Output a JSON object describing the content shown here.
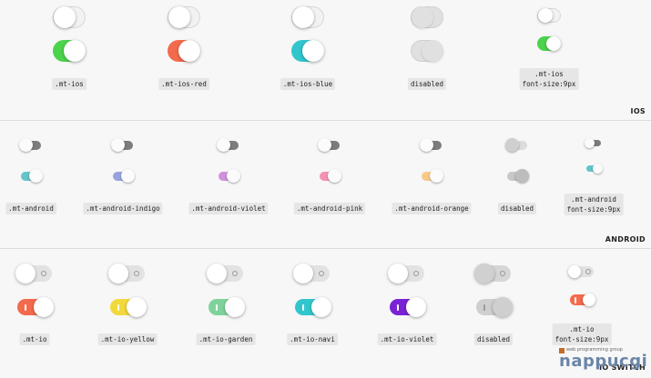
{
  "sections": {
    "ios": {
      "title": "IOS"
    },
    "android": {
      "title": "ANDROID"
    },
    "ioswitch": {
      "title": "IO SWITCH"
    }
  },
  "ios": [
    {
      "label": ".mt-ios",
      "color": "#4cd34c",
      "off": false,
      "on": true
    },
    {
      "label": ".mt-ios-red",
      "color": "#f46a4c",
      "off": false,
      "on": true
    },
    {
      "label": ".mt-ios-blue",
      "color": "#31c6cc",
      "off": false,
      "on": true
    },
    {
      "label": "disabled",
      "color": "#e0e0e0",
      "off": false,
      "on": true
    },
    {
      "label": ".mt-ios\nfont-size:9px",
      "color": "#4cd34c",
      "off": false,
      "on": true
    }
  ],
  "android": [
    {
      "label": ".mt-android",
      "color": "#64c4c8"
    },
    {
      "label": ".mt-android-indigo",
      "color": "#97a3dc"
    },
    {
      "label": ".mt-android-violet",
      "color": "#cf90dc"
    },
    {
      "label": ".mt-android-pink",
      "color": "#f291b3"
    },
    {
      "label": ".mt-android-orange",
      "color": "#f9c98a"
    },
    {
      "label": "disabled",
      "color": "#c8c8c8"
    },
    {
      "label": ".mt-android\nfont-size:9px",
      "color": "#64c4c8"
    }
  ],
  "io": [
    {
      "label": ".mt-io",
      "color": "#f46a4c"
    },
    {
      "label": ".mt-io-yellow",
      "color": "#f2d93b"
    },
    {
      "label": ".mt-io-garden",
      "color": "#7fd39a"
    },
    {
      "label": ".mt-io-navi",
      "color": "#31c6cc"
    },
    {
      "label": ".mt-io-violet",
      "color": "#7a22d6"
    },
    {
      "label": "disabled",
      "color": "#cfcfcf"
    },
    {
      "label": ".mt-io\nfont-size:9px",
      "color": "#f46a4c"
    }
  ],
  "watermark": {
    "small": "web programming group",
    "big": "nappucgi"
  }
}
